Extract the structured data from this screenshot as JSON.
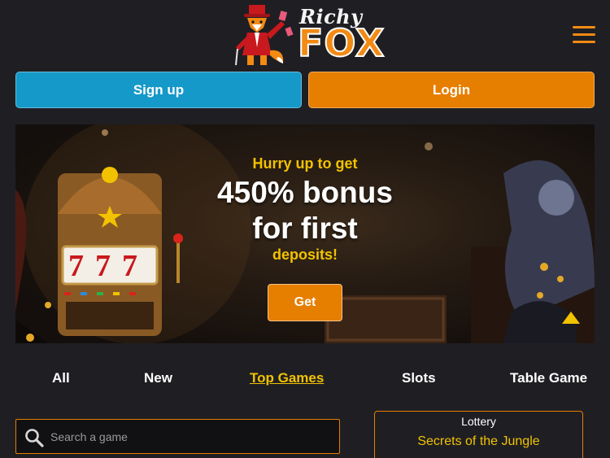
{
  "header": {
    "logo_text_top": "Richy",
    "logo_text_bottom": "FOX",
    "menu_icon": "hamburger-menu-icon"
  },
  "auth": {
    "signup_label": "Sign up",
    "login_label": "Login"
  },
  "banner": {
    "pre_title": "Hurry up to get",
    "title_line1": "450% bonus",
    "title_line2": "for first",
    "post_title": "deposits!",
    "cta_label": "Get",
    "scroll_icon": "triangle-up-icon"
  },
  "tabs": [
    {
      "label": "All",
      "active": false
    },
    {
      "label": "New",
      "active": false
    },
    {
      "label": "Top Games",
      "active": true
    },
    {
      "label": "Slots",
      "active": false
    },
    {
      "label": "Table Game",
      "active": false
    }
  ],
  "search": {
    "placeholder": "Search a game",
    "icon": "search-icon"
  },
  "lottery": {
    "label": "Lottery",
    "name": "Secrets of the Jungle"
  },
  "colors": {
    "background": "#1f1f23",
    "accent_orange": "#e67e00",
    "signup_blue": "#1499c9",
    "highlight_yellow": "#f2c200"
  }
}
